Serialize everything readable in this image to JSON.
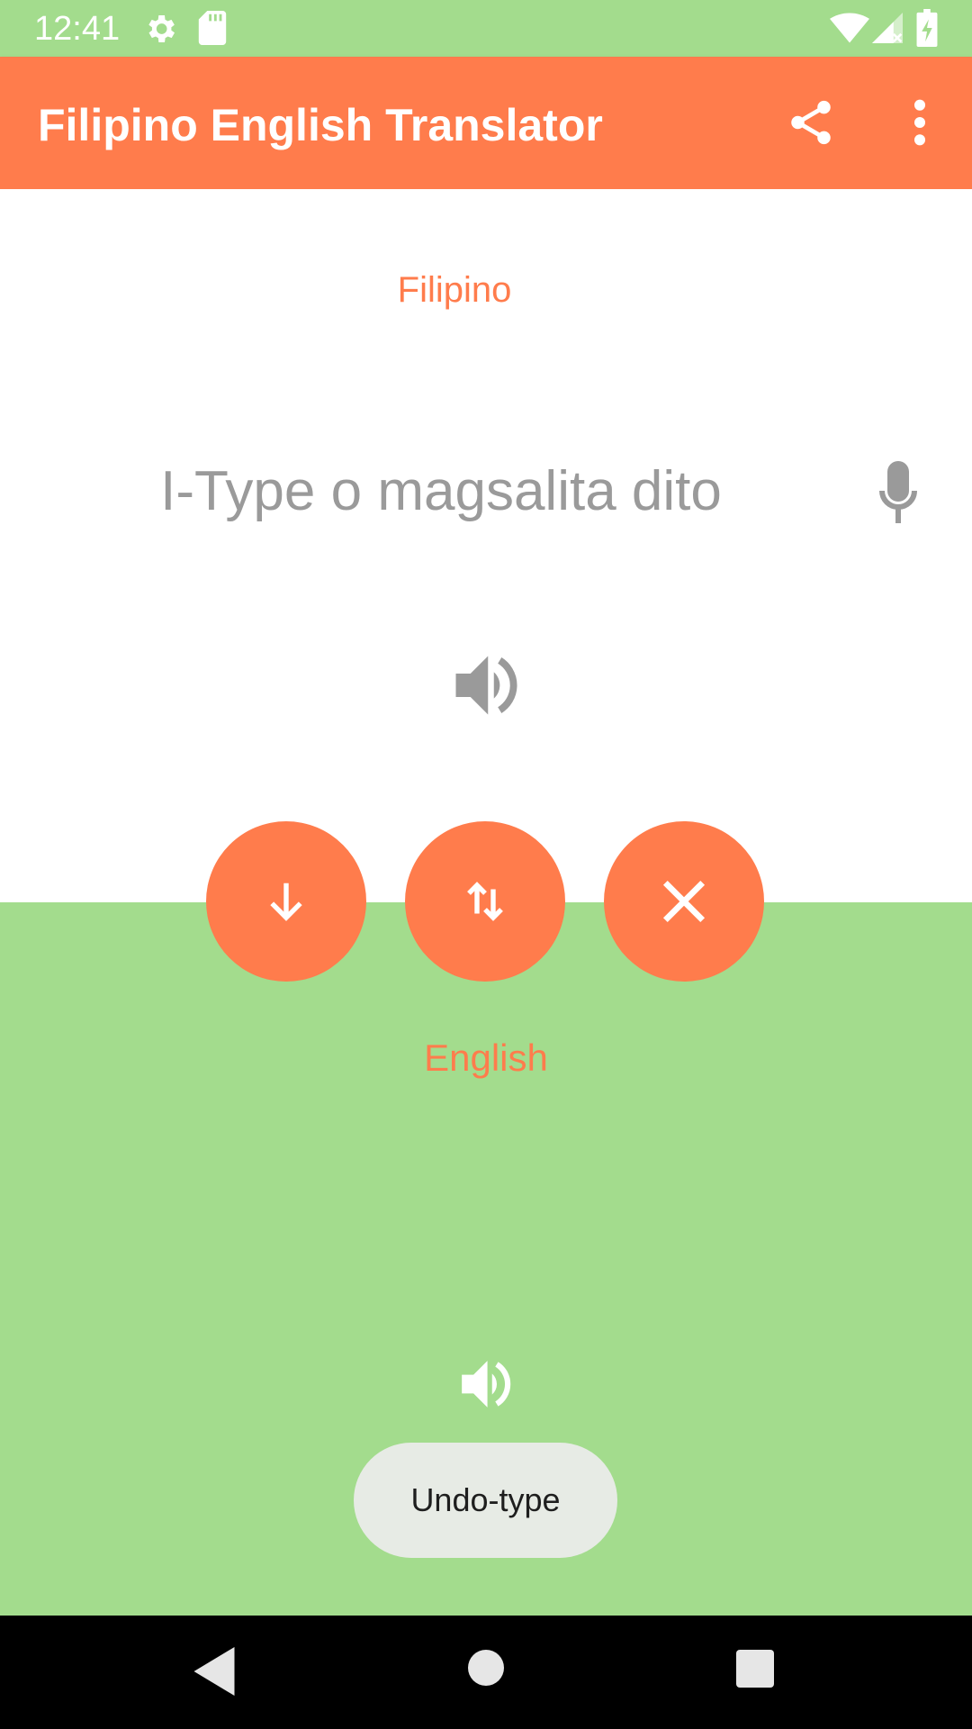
{
  "status_bar": {
    "time": "12:41"
  },
  "app_bar": {
    "title": "Filipino English Translator"
  },
  "source": {
    "language": "Filipino",
    "placeholder": "I-Type o magsalita dito",
    "value": ""
  },
  "target": {
    "language": "English"
  },
  "toast": {
    "text": "Undo-type"
  },
  "colors": {
    "accent": "#ff7c4c",
    "green": "#a3dc8d",
    "white": "#ffffff",
    "icon_gray": "#9a9a9a",
    "toast_bg": "#e7ebe5",
    "nav_bg": "#000000"
  },
  "icons": {
    "status": [
      "gear-icon",
      "sd-card-icon",
      "wifi-icon",
      "signal-icon",
      "battery-icon"
    ],
    "app_bar": [
      "share-icon",
      "more-vert-icon"
    ],
    "source": [
      "mic-icon",
      "speaker-icon"
    ],
    "actions": [
      "arrow-down-icon",
      "swap-vertical-icon",
      "close-icon"
    ],
    "target": [
      "speaker-icon"
    ],
    "nav": [
      "back-icon",
      "home-icon",
      "recents-icon"
    ]
  }
}
